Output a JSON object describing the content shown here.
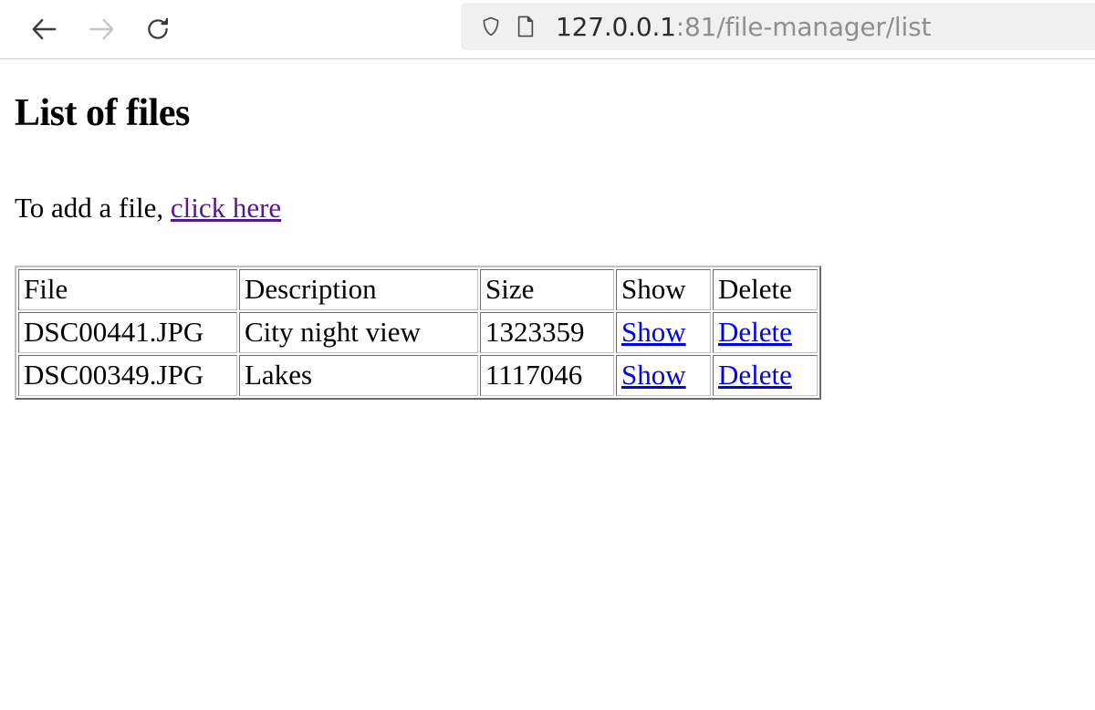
{
  "browser": {
    "back_label": "Back",
    "forward_label": "Forward",
    "reload_label": "Reload",
    "back_icon": "arrow-left-icon",
    "forward_icon": "arrow-right-icon",
    "reload_icon": "reload-icon",
    "shield_icon": "shield-icon",
    "page_icon": "page-icon",
    "url_host": "127.0.0.1",
    "url_rest": ":81/file-manager/list",
    "url_full": "127.0.0.1:81/file-manager/list"
  },
  "page": {
    "title": "List of files",
    "add_prefix": "To add a file, ",
    "add_link_label": "click here"
  },
  "table": {
    "headers": {
      "file": "File",
      "description": "Description",
      "size": "Size",
      "show": "Show",
      "delete": "Delete"
    },
    "rows": [
      {
        "file": "DSC00441.JPG",
        "description": "City night view",
        "size": "1323359",
        "show": "Show",
        "delete": "Delete"
      },
      {
        "file": "DSC00349.JPG",
        "description": "Lakes",
        "size": "1117046",
        "show": "Show",
        "delete": "Delete"
      }
    ]
  },
  "colors": {
    "link_unvisited": "#0000ee",
    "link_visited": "#551a8b",
    "url_host_text": "#2b2b2b",
    "url_rest_text": "#8f8f8f",
    "urlbar_background": "#f0f0f0",
    "table_border": "#c0c0c0",
    "page_background": "#ffffff"
  }
}
